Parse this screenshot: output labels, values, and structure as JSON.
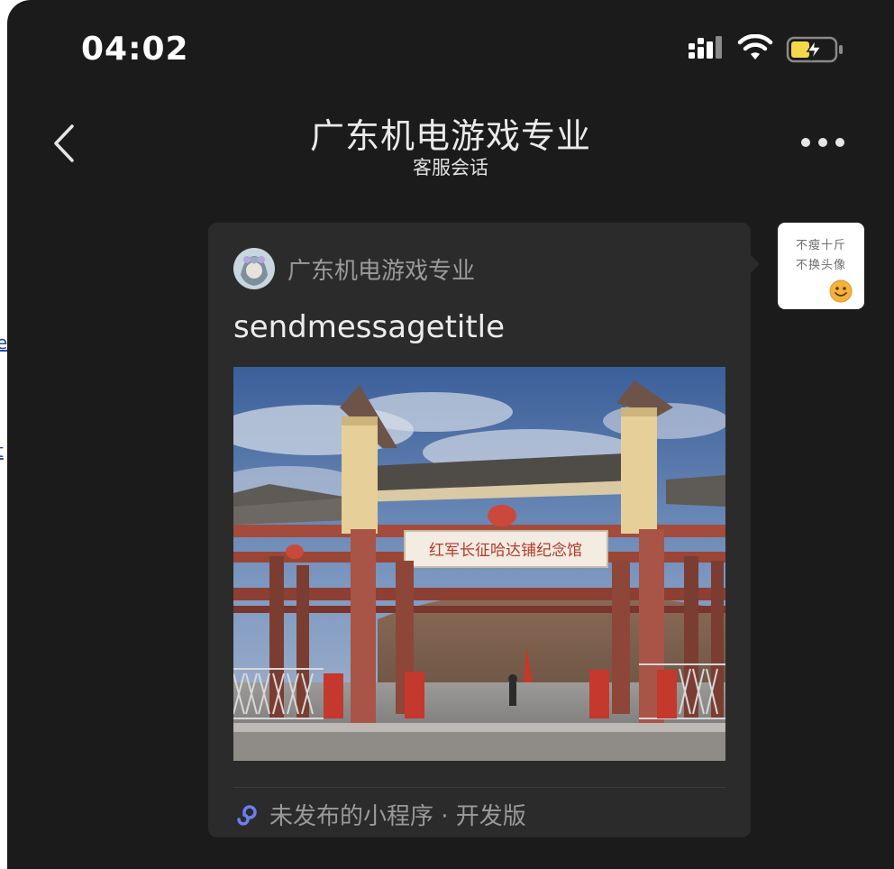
{
  "background": {
    "links": [
      "e",
      "t"
    ]
  },
  "status_bar": {
    "time": "04:02",
    "icons": [
      "signal-icon",
      "wifi-icon",
      "battery-charging-icon"
    ]
  },
  "nav": {
    "back_icon": "chevron-left-icon",
    "title": "广东机电游戏专业",
    "subtitle": "客服会话",
    "more_icon": "more-horizontal-icon"
  },
  "message_card": {
    "source_name": "广东机电游戏专业",
    "title": "sendmessagetitle",
    "image_sign_text": "红军长征哈达铺纪念馆",
    "footer_icon": "mini-program-icon",
    "footer_text": "未发布的小程序 · 开发版"
  },
  "user_avatar": {
    "line1": "不瘦十斤",
    "line2": "不换头像",
    "icon": "smiley-icon"
  },
  "colors": {
    "background": "#1b1b1b",
    "card": "#2b2b2b",
    "text_primary": "#ececec",
    "text_secondary": "#9a9a9a",
    "battery": "#f5d84a",
    "accent_icon": "#5b6fd6"
  }
}
